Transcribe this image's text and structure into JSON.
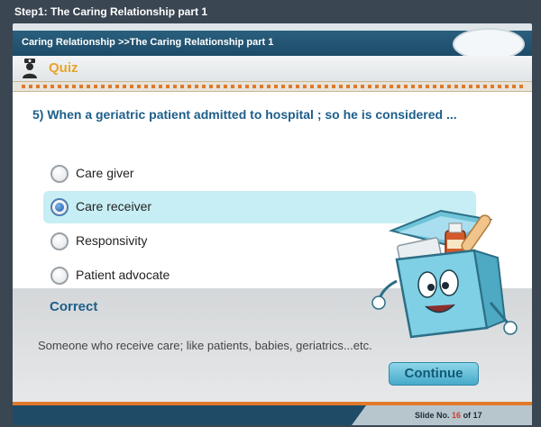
{
  "window": {
    "title": "Step1: The Caring Relationship part 1"
  },
  "breadcrumb": {
    "text": "Caring Relationship >>The Caring  Relationship part 1"
  },
  "quiz": {
    "label": "Quiz"
  },
  "question": {
    "text": "5) When a geriatric patient admitted to hospital ; so he is considered ..."
  },
  "options": [
    {
      "label": "Care giver",
      "selected": false
    },
    {
      "label": "Care receiver",
      "selected": true
    },
    {
      "label": "Responsivity",
      "selected": false
    },
    {
      "label": "Patient advocate",
      "selected": false
    }
  ],
  "feedback": {
    "title": "Correct",
    "text": "Someone who receive care; like patients, babies, geriatrics...etc."
  },
  "continue_button": {
    "label": "Continue"
  },
  "footer": {
    "slide_label": "Slide No.",
    "current": "16",
    "of_label": "of",
    "total": "17"
  },
  "colors": {
    "accent_orange": "#e07a2a",
    "title_blue": "#1d5e8a",
    "selected_bg": "#c7eef4"
  }
}
